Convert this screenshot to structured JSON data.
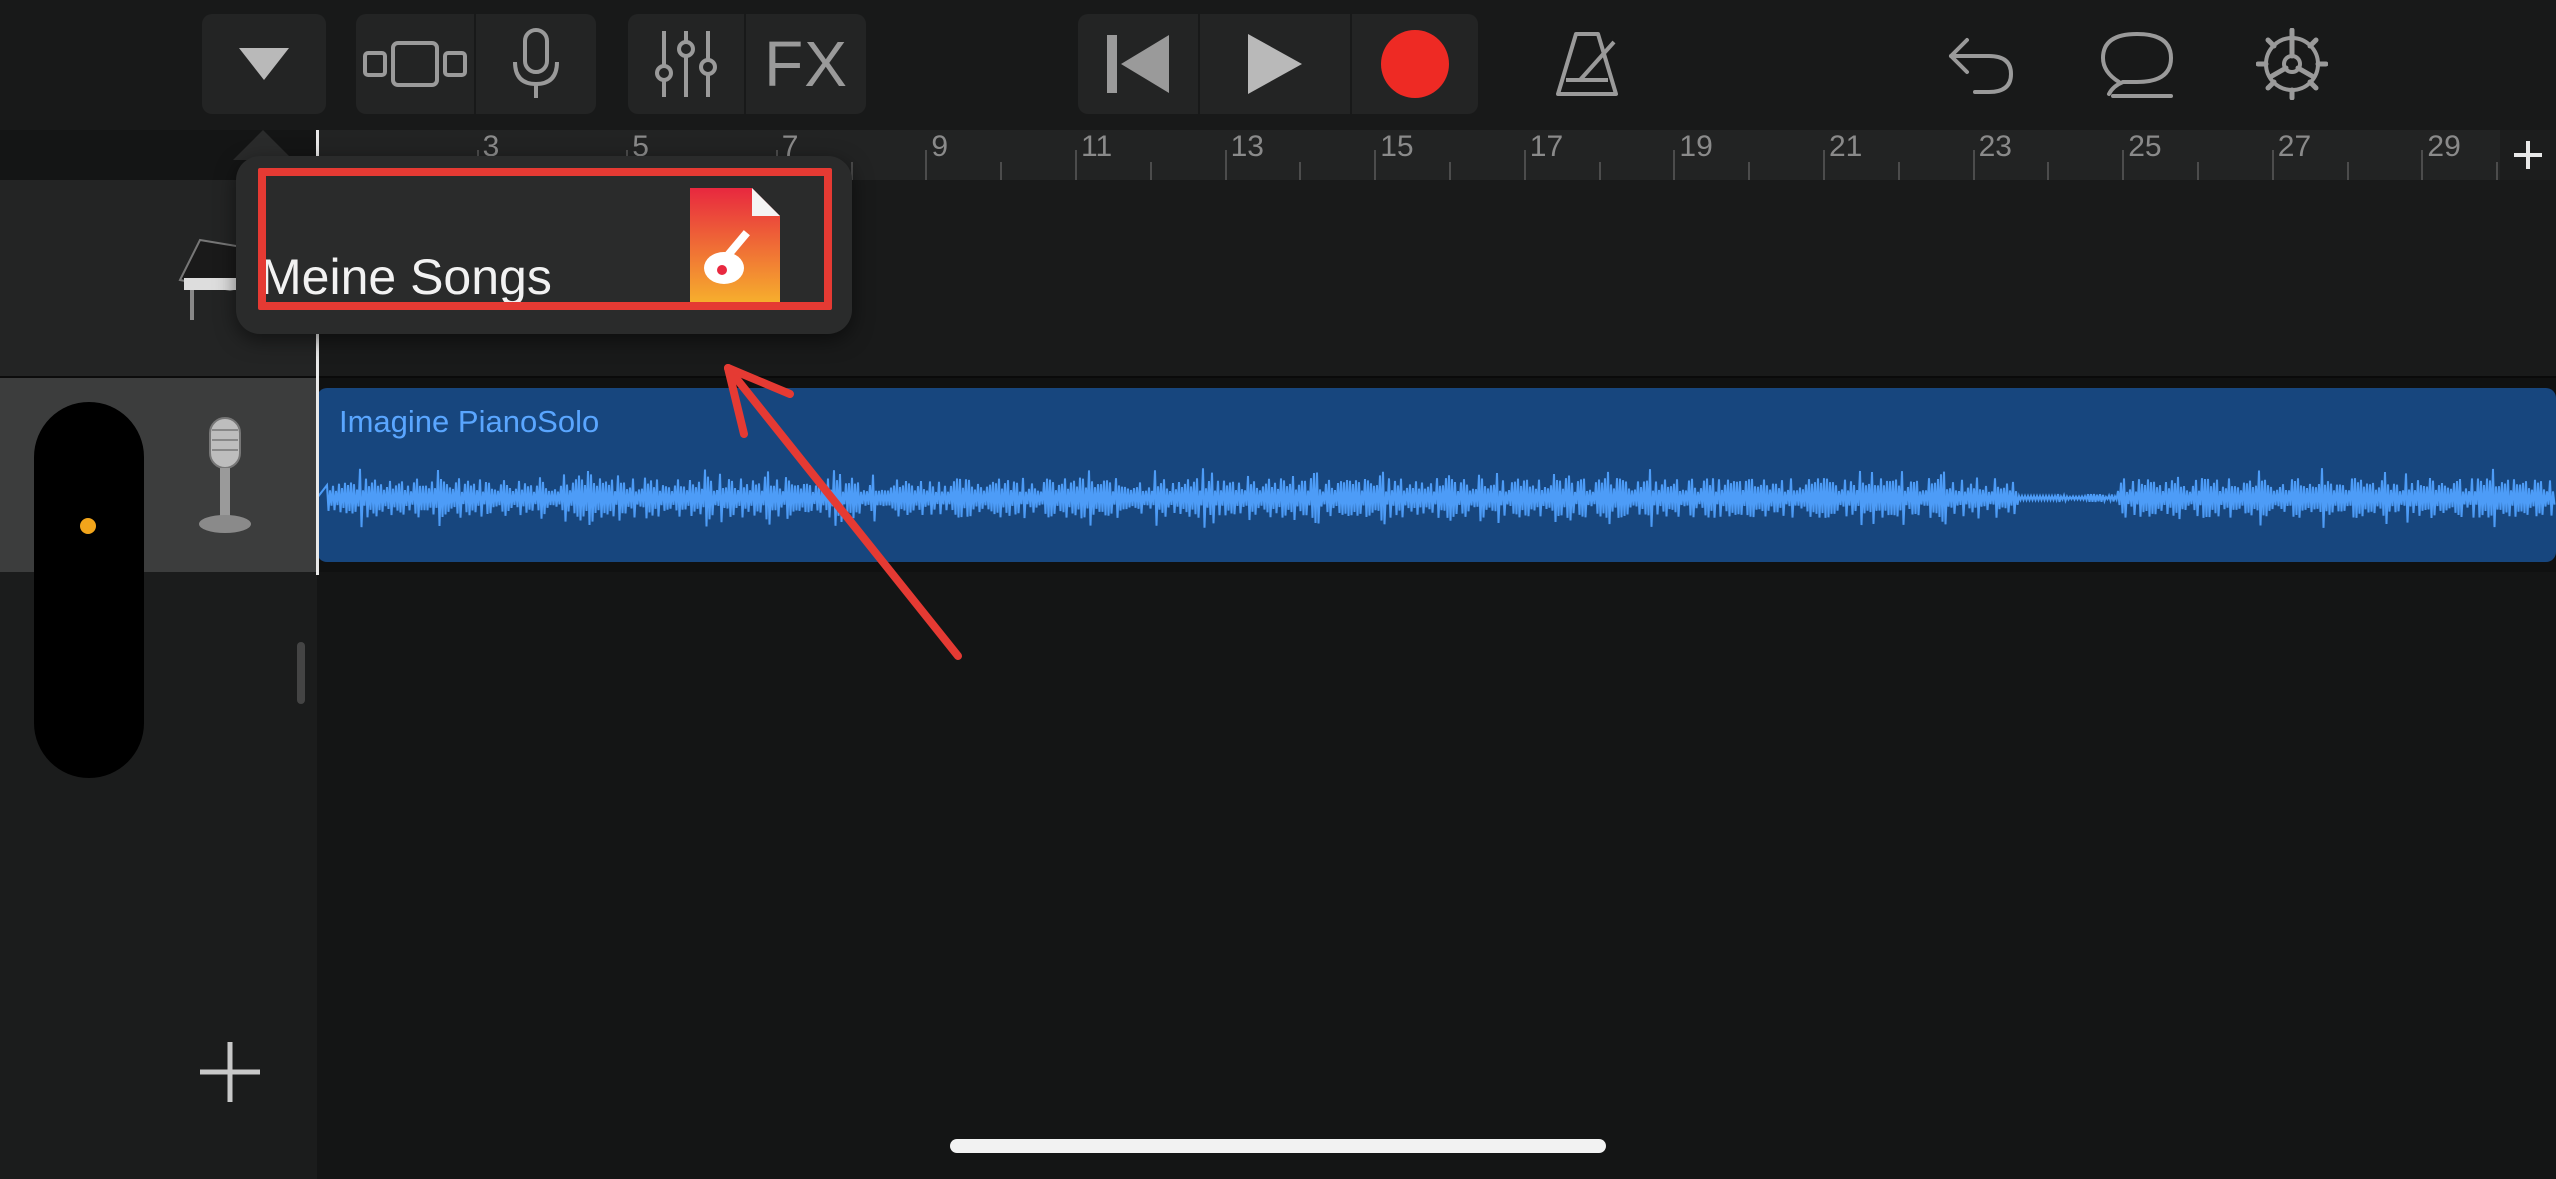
{
  "toolbar": {
    "browser_button": "browser-dropdown",
    "view_toggle": "tracks-view-toggle",
    "fx_label": "FX"
  },
  "ruler": {
    "bars": [
      "3",
      "5",
      "7",
      "9",
      "11",
      "13",
      "15",
      "17",
      "19",
      "21",
      "23",
      "25",
      "27",
      "29"
    ]
  },
  "popover": {
    "item_label": "Meine Songs",
    "item_icon": "garageband-file-icon"
  },
  "tracks": [
    {
      "name": "grand-piano-track",
      "icon": "piano-icon"
    },
    {
      "name": "audio-recorder-track",
      "icon": "microphone-icon",
      "region_label": "Imagine PianoSolo"
    }
  ],
  "colors": {
    "record": "#ee2a24",
    "region": "#17467e",
    "waveform": "#4d9cf7",
    "annotation": "#e53a33",
    "level_dot": "#f2a51b"
  }
}
